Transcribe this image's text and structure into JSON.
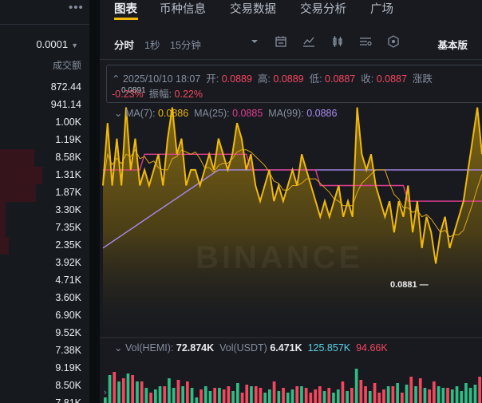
{
  "orderbook": {
    "menu_icon": "more-dots-icon",
    "precision": "0.0001",
    "column_header": "成交额",
    "rows": [
      {
        "value": "872.44",
        "depth": 0.0
      },
      {
        "value": "941.14",
        "depth": 0.0
      },
      {
        "value": "1.00K",
        "depth": 0.0
      },
      {
        "value": "1.19K",
        "depth": 0.0
      },
      {
        "value": "8.58K",
        "depth": 0.38
      },
      {
        "value": "1.31K",
        "depth": 0.47
      },
      {
        "value": "1.87K",
        "depth": 0.4
      },
      {
        "value": "3.30K",
        "depth": 0.06
      },
      {
        "value": "7.35K",
        "depth": 0.06
      },
      {
        "value": "2.35K",
        "depth": 0.1
      },
      {
        "value": "3.92K",
        "depth": 0.0
      },
      {
        "value": "4.71K",
        "depth": 0.0
      },
      {
        "value": "3.60K",
        "depth": 0.0
      },
      {
        "value": "6.90K",
        "depth": 0.0
      },
      {
        "value": "9.52K",
        "depth": 0.0
      },
      {
        "value": "7.38K",
        "depth": 0.0
      },
      {
        "value": "9.19K",
        "depth": 0.0
      },
      {
        "value": "8.50K",
        "depth": 0.0
      },
      {
        "value": "7.81K",
        "depth": 0.0
      }
    ]
  },
  "tabs": [
    "图表",
    "币种信息",
    "交易数据",
    "交易分析",
    "广场"
  ],
  "active_tab": "图表",
  "toolbar": {
    "intervals": [
      "分时",
      "1秒",
      "15分钟"
    ],
    "active_interval": "分时",
    "icons": [
      "dropdown-caret-icon",
      "calendar-icon",
      "line-chart-icon",
      "candlestick-icon",
      "indicator-settings-icon",
      "hexagon-icon"
    ],
    "view_mode": "基本版"
  },
  "ohlc": {
    "datetime": "2025/10/10 18:07",
    "open_label": "开:",
    "open": "0.0889",
    "high_label": "高:",
    "high": "0.0889",
    "low_label": "低:",
    "low": "0.0887",
    "close_label": "收:",
    "close": "0.0887",
    "change_label": "涨跌",
    "change_pct": "-0.23%",
    "amplitude_label": "振幅:",
    "amplitude": "0.22%",
    "overlap_price": "0.0891"
  },
  "ma": {
    "ma7_label": "MA(7):",
    "ma7": "0.0886",
    "ma25_label": "MA(25):",
    "ma25": "0.0885",
    "ma99_label": "MA(99):",
    "ma99": "0.0886"
  },
  "low_marker": "0.0881",
  "watermark": "BINANCE",
  "volume": {
    "label1": "Vol(HEMI):",
    "value1": "72.874K",
    "label2": "Vol(USDT)",
    "value2": "6.471K",
    "value3": "125.857K",
    "value4": "94.66K"
  },
  "colors": {
    "up": "#2ebd85",
    "down": "#f6465d",
    "accent": "#f0b90b",
    "ma25": "#e03e92",
    "ma99": "#a98bf0",
    "vol_ma": "#5cd1e5"
  },
  "chart_data": {
    "type": "area",
    "series": [
      {
        "values": [
          0.0886,
          0.089,
          0.0886,
          0.0889,
          0.0886,
          0.0891,
          0.0887,
          0.0889,
          0.0886,
          0.0887,
          0.0886,
          0.0887,
          0.0888,
          0.0886,
          0.0889,
          0.0891,
          0.0888,
          0.0889,
          0.0886,
          0.0887,
          0.0887,
          0.0886,
          0.0887,
          0.0888,
          0.0887,
          0.0889,
          0.0888,
          0.0887,
          0.0888,
          0.089,
          0.0889,
          0.0887,
          0.0888,
          0.0886,
          0.0885,
          0.0886,
          0.0887,
          0.0885,
          0.0886,
          0.0885,
          0.0886,
          0.0887,
          0.0886,
          0.0888,
          0.0887,
          0.0886,
          0.0885,
          0.0884,
          0.0885,
          0.0884,
          0.0885,
          0.0886,
          0.0884,
          0.0885,
          0.0884,
          0.0891,
          0.0888,
          0.0887,
          0.0888,
          0.0886,
          0.0885,
          0.0884,
          0.0885,
          0.0883,
          0.0885,
          0.0884,
          0.0886,
          0.0883,
          0.0885,
          0.0882,
          0.0884,
          0.0883,
          0.0881,
          0.0883,
          0.0884,
          0.0882,
          0.0883,
          0.0884,
          0.0885,
          0.0887,
          0.0889,
          0.0891,
          0.0888
        ]
      },
      {
        "name": "MA(25)",
        "values": [
          0.0887,
          0.0887,
          0.0887,
          0.0887,
          0.0887,
          0.0887,
          0.0887,
          0.0887,
          0.0887,
          0.0888,
          0.0888,
          0.0888,
          0.0888,
          0.0888,
          0.0888,
          0.0888,
          0.0888,
          0.0888,
          0.0888,
          0.0888,
          0.0888,
          0.0888,
          0.0888,
          0.0888,
          0.0888,
          0.0888,
          0.0888,
          0.0888,
          0.0888,
          0.0888,
          0.0888,
          0.0888,
          0.0887,
          0.0887,
          0.0887,
          0.0887,
          0.0887,
          0.0887,
          0.0887,
          0.0887,
          0.0887,
          0.0887,
          0.0887,
          0.0887,
          0.0887,
          0.0887,
          0.0887,
          0.0886,
          0.0886,
          0.0886,
          0.0886,
          0.0886,
          0.0886,
          0.0886,
          0.0886,
          0.0886,
          0.0886,
          0.0886,
          0.0886,
          0.0886,
          0.0886,
          0.0886,
          0.0886,
          0.0886,
          0.0886,
          0.0886,
          0.0885,
          0.0885,
          0.0885,
          0.0885,
          0.0885,
          0.0885,
          0.0885,
          0.0885,
          0.0885,
          0.0885,
          0.0885,
          0.0885,
          0.0885,
          0.0885,
          0.0885,
          0.0885,
          0.0885
        ]
      },
      {
        "name": "MA(99)",
        "values": [
          0.0882,
          0.08822,
          0.08824,
          0.08826,
          0.08828,
          0.0883,
          0.08832,
          0.08834,
          0.08836,
          0.08838,
          0.0884,
          0.08842,
          0.08844,
          0.08846,
          0.08848,
          0.0885,
          0.08852,
          0.08854,
          0.08856,
          0.08858,
          0.0886,
          0.08862,
          0.08864,
          0.08866,
          0.08868,
          0.0887,
          0.0887,
          0.0887,
          0.0887,
          0.0887,
          0.0887,
          0.0887,
          0.0887,
          0.0887,
          0.0887,
          0.0887,
          0.0887,
          0.0887,
          0.0887,
          0.0887,
          0.0887,
          0.0887,
          0.0887,
          0.0887,
          0.0887,
          0.0887,
          0.0887,
          0.0887,
          0.0887,
          0.0887,
          0.0887,
          0.0887,
          0.0887,
          0.0887,
          0.0887,
          0.0887,
          0.0887,
          0.0887,
          0.0887,
          0.0887,
          0.0887,
          0.0887,
          0.0887,
          0.0887,
          0.0887,
          0.0887,
          0.0887,
          0.0887,
          0.0887,
          0.0887,
          0.0887,
          0.0887,
          0.0887,
          0.0887,
          0.0887,
          0.0887,
          0.0887,
          0.0887,
          0.0887,
          0.0887,
          0.0887,
          0.0887,
          0.0887
        ]
      }
    ]
  }
}
